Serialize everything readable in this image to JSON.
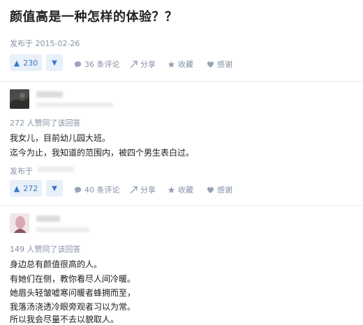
{
  "question": {
    "title": "颜值高是一种怎样的体验？？",
    "published": "发布于 2015-02-26",
    "vote_count": "230",
    "actions": {
      "comments": "36 条评论",
      "share": "分享",
      "collect": "收藏",
      "thanks": "感谢"
    }
  },
  "answers": [
    {
      "likes": "272 人赞同了该回答",
      "lines": [
        "我女儿，目前幼儿园大班。",
        "迄今为止，我知道的范围内，被四个男生表白过。"
      ],
      "published_prefix": "发布于",
      "vote_count": "272",
      "actions": {
        "comments": "40 条评论",
        "share": "分享",
        "collect": "收藏",
        "thanks": "感谢"
      }
    },
    {
      "likes": "149 人赞同了该回答",
      "lines": [
        "身边总有颜值很高的人。",
        "有她们在侧，教你看尽人间冷暖。",
        "她眉头轻皱嘘寒问暖者蜂拥而至，",
        "我落汤浇透冷眼旁观者习以为常。",
        "所以我会尽量不去以貌取人。"
      ]
    }
  ],
  "icons": {
    "up": "arrow-up-icon",
    "down": "arrow-down-icon",
    "comment": "comment-bubble-icon",
    "share": "share-icon",
    "collect": "star-icon",
    "thanks": "heart-icon"
  },
  "colors": {
    "accent": "#3e7ac2",
    "vote_bg": "#e8f0fa",
    "meta": "#8590a6"
  }
}
